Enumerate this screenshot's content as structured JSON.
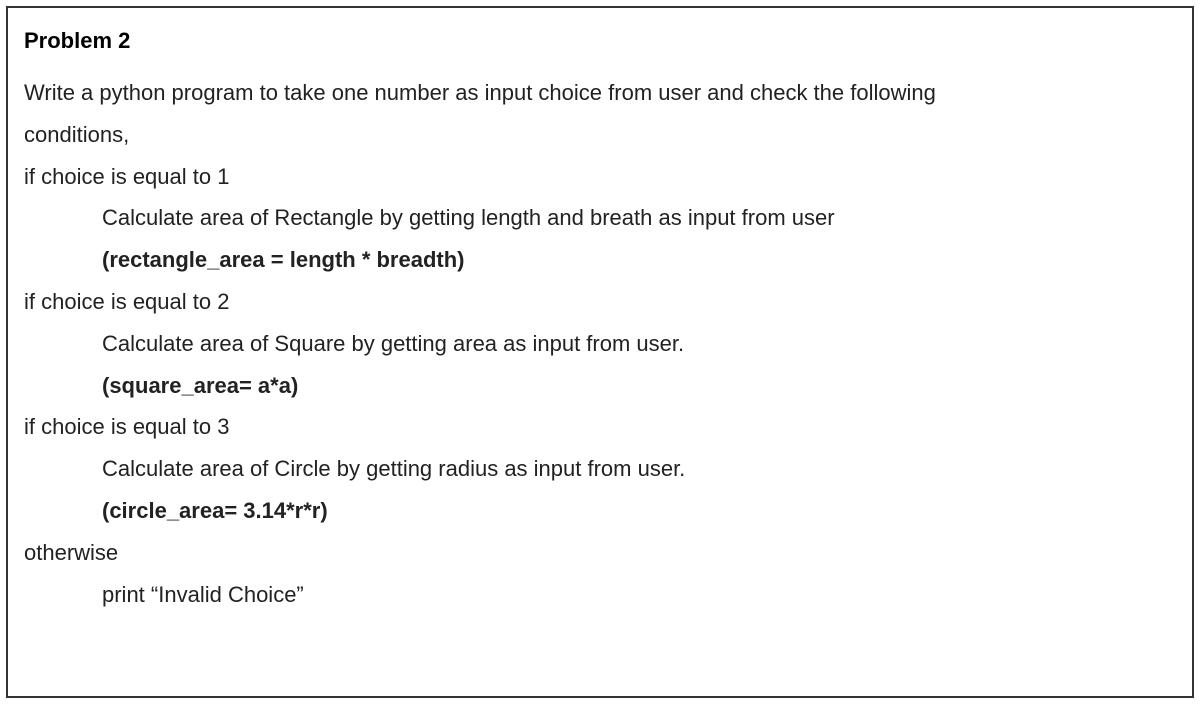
{
  "problem": {
    "title": "Problem 2",
    "intro1": "Write a python program to take one number as input choice from user and check the following",
    "intro2": "conditions,",
    "cond1": "if choice is equal to 1",
    "cond1_desc": "Calculate area of Rectangle by getting length and breath as input from user",
    "cond1_formula": "(rectangle_area = length * breadth)",
    "cond2": "if choice is equal to 2",
    "cond2_desc": "Calculate area of Square by getting area as input from user.",
    "cond2_formula": "(square_area= a*a)",
    "cond3": "if choice is equal to 3",
    "cond3_desc": "Calculate area of Circle by getting radius as input from user.",
    "cond3_formula": "(circle_area= 3.14*r*r)",
    "otherwise": "otherwise",
    "otherwise_desc": "print “Invalid Choice”"
  }
}
